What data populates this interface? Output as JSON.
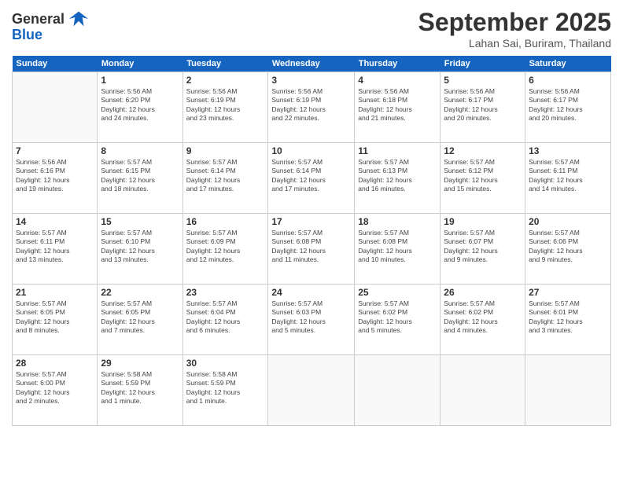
{
  "header": {
    "logo_line1": "General",
    "logo_line2": "Blue",
    "month": "September 2025",
    "location": "Lahan Sai, Buriram, Thailand"
  },
  "weekdays": [
    "Sunday",
    "Monday",
    "Tuesday",
    "Wednesday",
    "Thursday",
    "Friday",
    "Saturday"
  ],
  "weeks": [
    [
      {
        "day": "",
        "info": ""
      },
      {
        "day": "1",
        "info": "Sunrise: 5:56 AM\nSunset: 6:20 PM\nDaylight: 12 hours\nand 24 minutes."
      },
      {
        "day": "2",
        "info": "Sunrise: 5:56 AM\nSunset: 6:19 PM\nDaylight: 12 hours\nand 23 minutes."
      },
      {
        "day": "3",
        "info": "Sunrise: 5:56 AM\nSunset: 6:19 PM\nDaylight: 12 hours\nand 22 minutes."
      },
      {
        "day": "4",
        "info": "Sunrise: 5:56 AM\nSunset: 6:18 PM\nDaylight: 12 hours\nand 21 minutes."
      },
      {
        "day": "5",
        "info": "Sunrise: 5:56 AM\nSunset: 6:17 PM\nDaylight: 12 hours\nand 20 minutes."
      },
      {
        "day": "6",
        "info": "Sunrise: 5:56 AM\nSunset: 6:17 PM\nDaylight: 12 hours\nand 20 minutes."
      }
    ],
    [
      {
        "day": "7",
        "info": "Sunrise: 5:56 AM\nSunset: 6:16 PM\nDaylight: 12 hours\nand 19 minutes."
      },
      {
        "day": "8",
        "info": "Sunrise: 5:57 AM\nSunset: 6:15 PM\nDaylight: 12 hours\nand 18 minutes."
      },
      {
        "day": "9",
        "info": "Sunrise: 5:57 AM\nSunset: 6:14 PM\nDaylight: 12 hours\nand 17 minutes."
      },
      {
        "day": "10",
        "info": "Sunrise: 5:57 AM\nSunset: 6:14 PM\nDaylight: 12 hours\nand 17 minutes."
      },
      {
        "day": "11",
        "info": "Sunrise: 5:57 AM\nSunset: 6:13 PM\nDaylight: 12 hours\nand 16 minutes."
      },
      {
        "day": "12",
        "info": "Sunrise: 5:57 AM\nSunset: 6:12 PM\nDaylight: 12 hours\nand 15 minutes."
      },
      {
        "day": "13",
        "info": "Sunrise: 5:57 AM\nSunset: 6:11 PM\nDaylight: 12 hours\nand 14 minutes."
      }
    ],
    [
      {
        "day": "14",
        "info": "Sunrise: 5:57 AM\nSunset: 6:11 PM\nDaylight: 12 hours\nand 13 minutes."
      },
      {
        "day": "15",
        "info": "Sunrise: 5:57 AM\nSunset: 6:10 PM\nDaylight: 12 hours\nand 13 minutes."
      },
      {
        "day": "16",
        "info": "Sunrise: 5:57 AM\nSunset: 6:09 PM\nDaylight: 12 hours\nand 12 minutes."
      },
      {
        "day": "17",
        "info": "Sunrise: 5:57 AM\nSunset: 6:08 PM\nDaylight: 12 hours\nand 11 minutes."
      },
      {
        "day": "18",
        "info": "Sunrise: 5:57 AM\nSunset: 6:08 PM\nDaylight: 12 hours\nand 10 minutes."
      },
      {
        "day": "19",
        "info": "Sunrise: 5:57 AM\nSunset: 6:07 PM\nDaylight: 12 hours\nand 9 minutes."
      },
      {
        "day": "20",
        "info": "Sunrise: 5:57 AM\nSunset: 6:06 PM\nDaylight: 12 hours\nand 9 minutes."
      }
    ],
    [
      {
        "day": "21",
        "info": "Sunrise: 5:57 AM\nSunset: 6:05 PM\nDaylight: 12 hours\nand 8 minutes."
      },
      {
        "day": "22",
        "info": "Sunrise: 5:57 AM\nSunset: 6:05 PM\nDaylight: 12 hours\nand 7 minutes."
      },
      {
        "day": "23",
        "info": "Sunrise: 5:57 AM\nSunset: 6:04 PM\nDaylight: 12 hours\nand 6 minutes."
      },
      {
        "day": "24",
        "info": "Sunrise: 5:57 AM\nSunset: 6:03 PM\nDaylight: 12 hours\nand 5 minutes."
      },
      {
        "day": "25",
        "info": "Sunrise: 5:57 AM\nSunset: 6:02 PM\nDaylight: 12 hours\nand 5 minutes."
      },
      {
        "day": "26",
        "info": "Sunrise: 5:57 AM\nSunset: 6:02 PM\nDaylight: 12 hours\nand 4 minutes."
      },
      {
        "day": "27",
        "info": "Sunrise: 5:57 AM\nSunset: 6:01 PM\nDaylight: 12 hours\nand 3 minutes."
      }
    ],
    [
      {
        "day": "28",
        "info": "Sunrise: 5:57 AM\nSunset: 6:00 PM\nDaylight: 12 hours\nand 2 minutes."
      },
      {
        "day": "29",
        "info": "Sunrise: 5:58 AM\nSunset: 5:59 PM\nDaylight: 12 hours\nand 1 minute."
      },
      {
        "day": "30",
        "info": "Sunrise: 5:58 AM\nSunset: 5:59 PM\nDaylight: 12 hours\nand 1 minute."
      },
      {
        "day": "",
        "info": ""
      },
      {
        "day": "",
        "info": ""
      },
      {
        "day": "",
        "info": ""
      },
      {
        "day": "",
        "info": ""
      }
    ]
  ]
}
